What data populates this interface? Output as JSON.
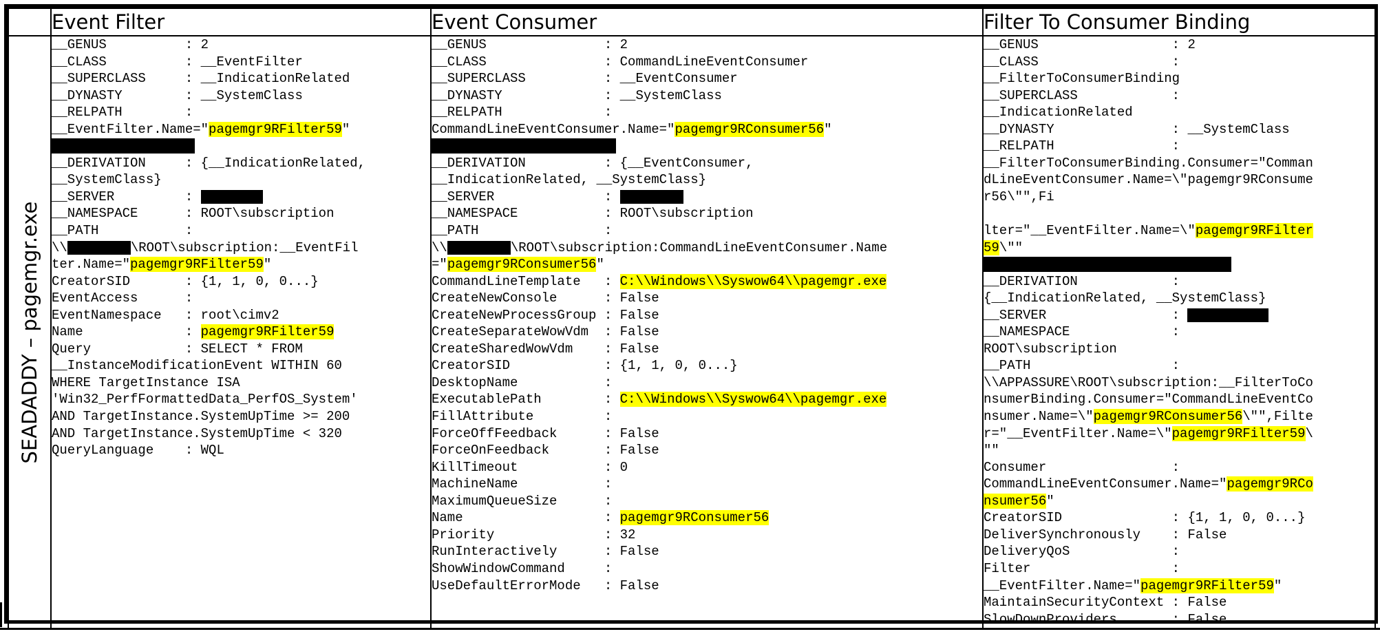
{
  "headers": {
    "event_filter": "Event Filter",
    "event_consumer": "Event Consumer",
    "binding": "Filter To Consumer Binding"
  },
  "row_label": "SEADADDY – pagemgr.exe",
  "highlight_color": "#ffff00",
  "redaction_color": "#000000",
  "event_filter_lines": [
    [
      "__GENUS          : 2"
    ],
    [
      "__CLASS          : __EventFilter"
    ],
    [
      "__SUPERCLASS     : __IndicationRelated"
    ],
    [
      "__DYNASTY        : __SystemClass"
    ],
    [
      "__RELPATH        :"
    ],
    [
      "__EventFilter.Name=\"",
      {
        "hl": "pagemgr9RFilter59"
      },
      "\""
    ],
    [],
    [
      "__DERIVATION     : {__IndicationRelated,"
    ],
    [
      "__SystemClass}"
    ],
    [
      "__SERVER         : "
    ],
    [
      "__NAMESPACE      : ROOT\\subscription"
    ],
    [
      "__PATH           :"
    ],
    [
      "\\\\",
      "\\ROOT\\subscription:__EventFil"
    ],
    [
      "ter.Name=\"",
      {
        "hl": "pagemgr9RFilter59"
      },
      "\""
    ],
    [
      "CreatorSID       : {1, 1, 0, 0...}"
    ],
    [
      "EventAccess      :"
    ],
    [
      "EventNamespace   : root\\cimv2"
    ],
    [
      "Name             : ",
      {
        "hl": "pagemgr9RFilter59"
      }
    ],
    [
      "Query            : SELECT * FROM"
    ],
    [
      "__InstanceModificationEvent WITHIN 60"
    ],
    [
      "WHERE TargetInstance ISA"
    ],
    [
      "'Win32_PerfFormattedData_PerfOS_System'"
    ],
    [
      "AND TargetInstance.SystemUpTime >= 200"
    ],
    [
      "AND TargetInstance.SystemUpTime < 320"
    ],
    [
      "QueryLanguage    : WQL"
    ]
  ],
  "event_consumer_lines": [
    [
      "__GENUS               : 2"
    ],
    [
      "__CLASS               : CommandLineEventConsumer"
    ],
    [
      "__SUPERCLASS          : __EventConsumer"
    ],
    [
      "__DYNASTY             : __SystemClass"
    ],
    [
      "__RELPATH             :"
    ],
    [
      "CommandLineEventConsumer.Name=\"",
      {
        "hl": "pagemgr9RConsumer56"
      },
      "\""
    ],
    [],
    [
      "__DERIVATION          : {__EventConsumer,"
    ],
    [
      "__IndicationRelated, __SystemClass}"
    ],
    [
      "__SERVER              : "
    ],
    [
      "__NAMESPACE           : ROOT\\subscription"
    ],
    [
      "__PATH                :"
    ],
    [
      "\\\\",
      "\\ROOT\\subscription:CommandLineEventConsumer.Name"
    ],
    [
      "=\"",
      {
        "hl": "pagemgr9RConsumer56"
      },
      "\""
    ],
    [
      "CommandLineTemplate   : ",
      {
        "hl": "C:\\\\Windows\\\\Syswow64\\\\pagemgr.exe"
      }
    ],
    [
      "CreateNewConsole      : False"
    ],
    [
      "CreateNewProcessGroup : False"
    ],
    [
      "CreateSeparateWowVdm  : False"
    ],
    [
      "CreateSharedWowVdm    : False"
    ],
    [
      "CreatorSID            : {1, 1, 0, 0...}"
    ],
    [
      "DesktopName           :"
    ],
    [
      "ExecutablePath        : ",
      {
        "hl": "C:\\\\Windows\\\\Syswow64\\\\pagemgr.exe"
      }
    ],
    [
      "FillAttribute         :"
    ],
    [
      "ForceOffFeedback      : False"
    ],
    [
      "ForceOnFeedback       : False"
    ],
    [
      "KillTimeout           : 0"
    ],
    [
      "MachineName           :"
    ],
    [
      "MaximumQueueSize      :"
    ],
    [
      "Name                  : ",
      {
        "hl": "pagemgr9RConsumer56"
      }
    ],
    [
      "Priority              : 32"
    ],
    [
      "RunInteractively      : False"
    ],
    [
      "ShowWindowCommand     :"
    ],
    [
      "UseDefaultErrorMode   : False"
    ]
  ],
  "binding_lines": [
    [
      "__GENUS                 : 2"
    ],
    [
      "__CLASS                 :"
    ],
    [
      "__FilterToConsumerBinding"
    ],
    [
      "__SUPERCLASS            :"
    ],
    [
      "__IndicationRelated"
    ],
    [
      "__DYNASTY               : __SystemClass"
    ],
    [
      "__RELPATH               :"
    ],
    [
      "__FilterToConsumerBinding.Consumer=\"Comman"
    ],
    [
      "dLineEventConsumer.Name=\\\"pagemgr9RConsume"
    ],
    [
      "r56\\\"\",Fi"
    ],
    [
      ""
    ],
    [
      "lter=\"__EventFilter.Name=\\\"",
      {
        "hl": "pagemgr9RFilter"
      }
    ],
    [
      {
        "hl": "59"
      },
      "\\\"\""
    ],
    [],
    [
      "__DERIVATION            :"
    ],
    [
      "{__IndicationRelated, __SystemClass}"
    ],
    [
      "__SERVER                : "
    ],
    [
      "__NAMESPACE             :"
    ],
    [
      "ROOT\\subscription"
    ],
    [
      "__PATH                  :"
    ],
    [
      "\\\\APPASSURE\\ROOT\\subscription:__FilterToCo"
    ],
    [
      "nsumerBinding.Consumer=\"CommandLineEventCo"
    ],
    [
      "nsumer.Name=\\\"",
      {
        "hl": "pagemgr9RConsumer56"
      },
      "\\\"\",Filte"
    ],
    [
      "r=\"__EventFilter.Name=\\\"",
      {
        "hl": "pagemgr9RFilter59"
      },
      "\\"
    ],
    [
      "\"\""
    ],
    [
      "Consumer                :"
    ],
    [
      "CommandLineEventConsumer.Name=\"",
      {
        "hl": "pagemgr9RCo"
      }
    ],
    [
      {
        "hl": "nsumer56"
      },
      "\""
    ],
    [
      "CreatorSID              : {1, 1, 0, 0...}"
    ],
    [
      "DeliverSynchronously    : False"
    ],
    [
      "DeliveryQoS             :"
    ],
    [
      "Filter                  :"
    ],
    [
      "__EventFilter.Name=\"",
      {
        "hl": "pagemgr9RFilter59"
      },
      "\""
    ],
    [
      "MaintainSecurityContext : False"
    ],
    [
      "SlowDownProviders       : False"
    ]
  ]
}
